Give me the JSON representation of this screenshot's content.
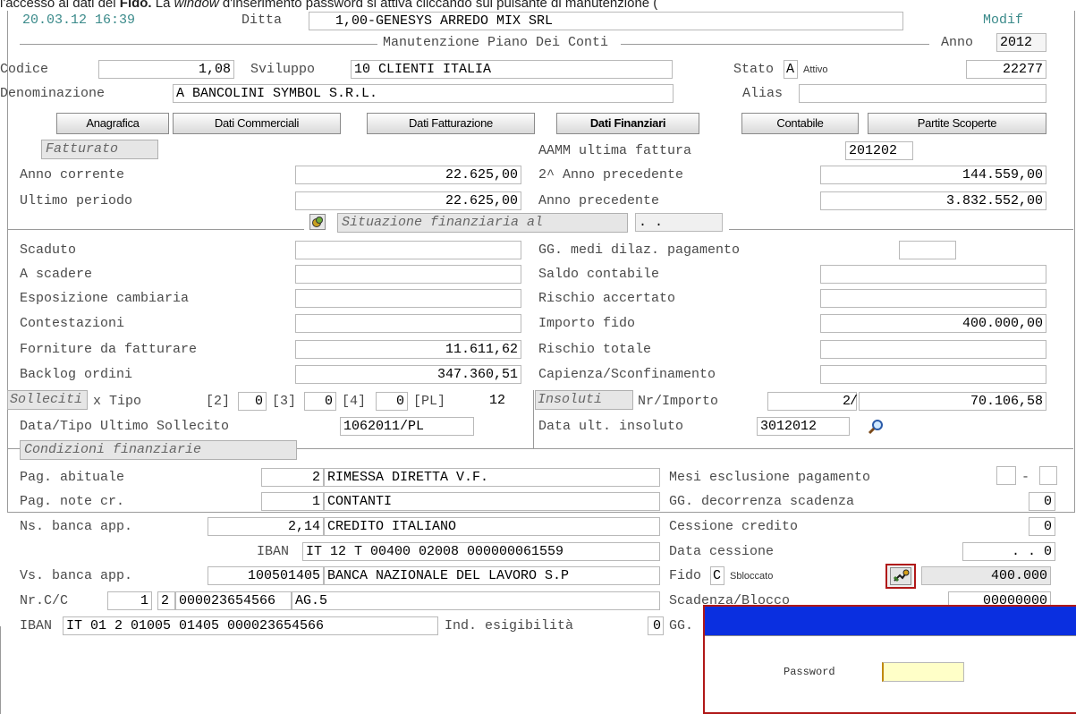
{
  "caption": {
    "prefix": "l'accesso ai dati del ",
    "bold": "Fido.",
    "middle": " La ",
    "italic": "window",
    "suffix": " d'inserimento password si attiva cliccando sul pulsante di manutenzione ("
  },
  "header": {
    "datetime": "20.03.12 16:39",
    "ditta_label": "Ditta",
    "ditta_code": "1,00",
    "ditta_name": "GENESYS ARREDO MIX SRL",
    "mode": "Modif",
    "title": "Manutenzione Piano Dei Conti",
    "anno_label": "Anno",
    "anno_value": "2012"
  },
  "account": {
    "codice_label": "Codice",
    "codice_value": "1,08",
    "sviluppo_label": "Sviluppo",
    "sviluppo_value": "10",
    "sviluppo_text": "CLIENTI ITALIA",
    "stato_label": "Stato",
    "stato_value": "A",
    "stato_text": "Attivo",
    "record_number": "22277",
    "denominazione_label": "Denominazione",
    "denominazione_value": "A BANCOLINI SYMBOL S.R.L.",
    "alias_label": "Alias",
    "alias_value": ""
  },
  "tabs": [
    {
      "label": "Anagrafica"
    },
    {
      "label": "Dati Commerciali"
    },
    {
      "label": "Dati Fatturazione"
    },
    {
      "label": "Dati Finanziari"
    },
    {
      "label": "Contabile"
    },
    {
      "label": "Partite Scoperte"
    }
  ],
  "fatturato": {
    "section_label": "Fatturato",
    "aamm_label": "AAMM ultima fattura",
    "aamm_value": "201202",
    "anno_corrente_label": "Anno corrente",
    "anno_corrente_value": "22.625,00",
    "ultimo_periodo_label": "Ultimo periodo",
    "ultimo_periodo_value": "22.625,00",
    "secondo_anno_label": "2^ Anno precedente",
    "secondo_anno_value": "144.559,00",
    "anno_prec_label": "Anno precedente",
    "anno_prec_value": "3.832.552,00"
  },
  "situazione": {
    "section_label": "Situazione finanziaria al",
    "date_value": ". .",
    "left": [
      {
        "label": "Scaduto",
        "value": ""
      },
      {
        "label": "A scadere",
        "value": ""
      },
      {
        "label": "Esposizione cambiaria",
        "value": ""
      },
      {
        "label": "Contestazioni",
        "value": ""
      },
      {
        "label": "Forniture da fatturare",
        "value": "11.611,62"
      },
      {
        "label": "Backlog ordini",
        "value": "347.360,51"
      }
    ],
    "gg_medi_label": "GG. medi dilaz. pagamento",
    "gg_medi_value": "",
    "right": [
      {
        "label": "Saldo contabile",
        "value": ""
      },
      {
        "label": "Rischio accertato",
        "value": ""
      },
      {
        "label": "Importo fido",
        "value": "400.000,00"
      },
      {
        "label": "Rischio totale",
        "value": ""
      },
      {
        "label": "Capienza/Sconfinamento",
        "value": ""
      }
    ]
  },
  "solleciti": {
    "section_label": "Solleciti",
    "tipo_label": "x Tipo",
    "t2_label": "[2]",
    "t2_value": "0",
    "t3_label": "[3]",
    "t3_value": "0",
    "t4_label": "[4]",
    "t4_value": "0",
    "pl_label": "[PL]",
    "pl_value": "12",
    "ultimo_label": "Data/Tipo Ultimo Sollecito",
    "ultimo_date": "1062011",
    "ultimo_tipo": "PL"
  },
  "insoluti": {
    "section_label": "Insoluti",
    "nr_label": "Nr/Importo",
    "nr_value": "2",
    "importo_value": "70.106,58",
    "data_label": "Data ult.  insoluto",
    "data_value": "3012012"
  },
  "condizioni": {
    "section_label": "Condizioni finanziarie",
    "pag_abituale_label": "Pag. abituale",
    "pag_abituale_code": "2",
    "pag_abituale_text": "RIMESSA DIRETTA V.F.",
    "pag_note_label": "Pag. note cr.",
    "pag_note_code": "1",
    "pag_note_text": "CONTANTI",
    "ns_banca_label": "Ns. banca app.",
    "ns_banca_code": "2,14",
    "ns_banca_text": "CREDITO ITALIANO",
    "iban1_label": "IBAN",
    "iban1_value": "IT 12 T 00400 02008 000000061559",
    "vs_banca_label": "Vs. banca app.",
    "vs_banca_code": "100501405",
    "vs_banca_text": "BANCA NAZIONALE DEL LAVORO S.P",
    "nrcc_label": "Nr.C/C",
    "nrcc_a": "1",
    "nrcc_b": "2",
    "nrcc_num": "000023654566",
    "nrcc_ag": "AG.5",
    "iban2_label": "IBAN",
    "iban2_value": "IT 01 2 01005 01405 000023654566",
    "ind_label": "Ind. esigibilità",
    "ind_value": "0",
    "mesi_label": "Mesi esclusione pagamento",
    "mesi_dash": "-",
    "gg_decorr_label": "GG. decorrenza scadenza",
    "gg_decorr_value": "0",
    "cessione_label": "Cessione credito",
    "cessione_value": "0",
    "data_cess_label": "Data cessione",
    "data_cess_value": ". .  0",
    "fido_label": "Fido",
    "fido_value": "C",
    "fido_text": "Sbloccato",
    "fido_amount": "400.000",
    "scad_label": "Scadenza/Blocco",
    "scad_value": "00000000",
    "gg_label": "GG."
  },
  "password_dialog": {
    "label": "Password",
    "value": ""
  }
}
